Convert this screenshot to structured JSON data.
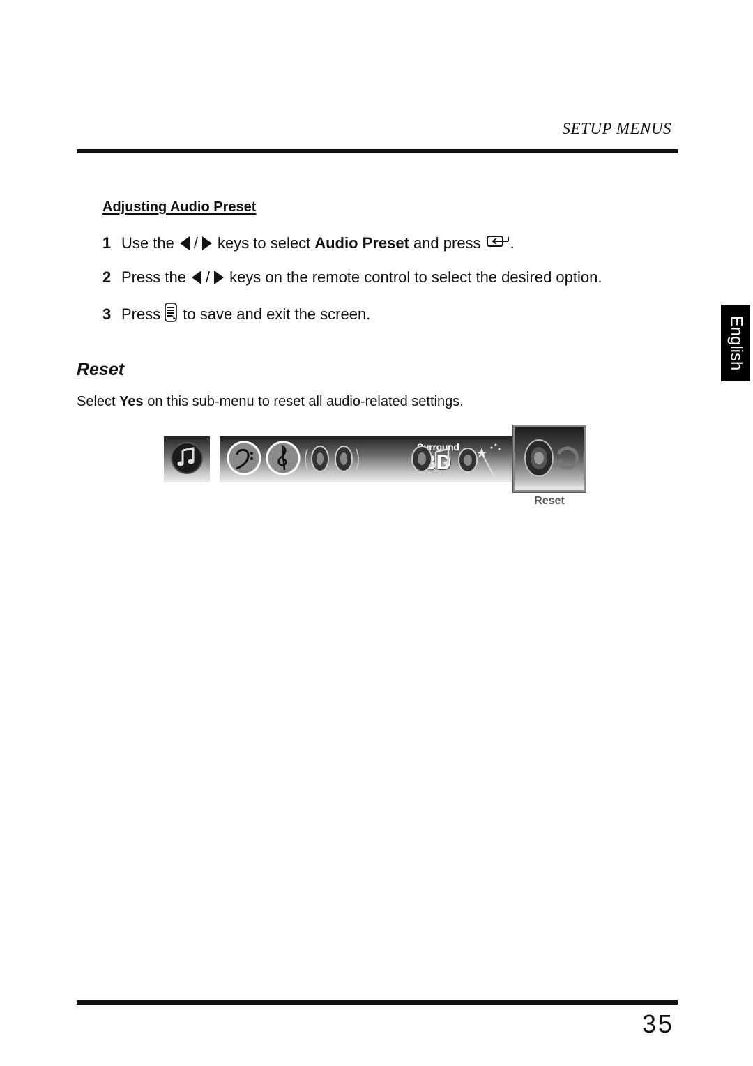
{
  "header": {
    "section_title": "SETUP MENUS"
  },
  "language_tab": {
    "label": "English"
  },
  "audio_preset": {
    "heading": "Adjusting Audio Preset",
    "steps": [
      {
        "number": "1",
        "pre": "Use the",
        "mid": "keys to select",
        "bold": "Audio Preset",
        "post": "and press",
        "end": "."
      },
      {
        "number": "2",
        "pre": "Press the",
        "post": "keys on the remote control to select the desired option."
      },
      {
        "number": "3",
        "pre": "Press",
        "post": "to save and exit the screen."
      }
    ],
    "separator": "/"
  },
  "reset_section": {
    "title": "Reset",
    "text_pre": "Select",
    "text_bold": "Yes",
    "text_post": "on this sub-menu to reset all audio-related settings."
  },
  "menu_strip": {
    "icons": [
      {
        "name": "music-note-icon"
      },
      {
        "name": "bass-clef-icon"
      },
      {
        "name": "treble-clef-icon"
      },
      {
        "name": "stereo-speakers-icon"
      },
      {
        "name": "surround-3d-icon"
      },
      {
        "name": "speaker-music-icon"
      },
      {
        "name": "speaker-magic-wand-icon"
      },
      {
        "name": "speaker-reset-icon"
      }
    ],
    "surround_line1": "Surround",
    "surround_line2": "3D",
    "selected_label": "Reset"
  },
  "footer": {
    "page_number": "35"
  }
}
